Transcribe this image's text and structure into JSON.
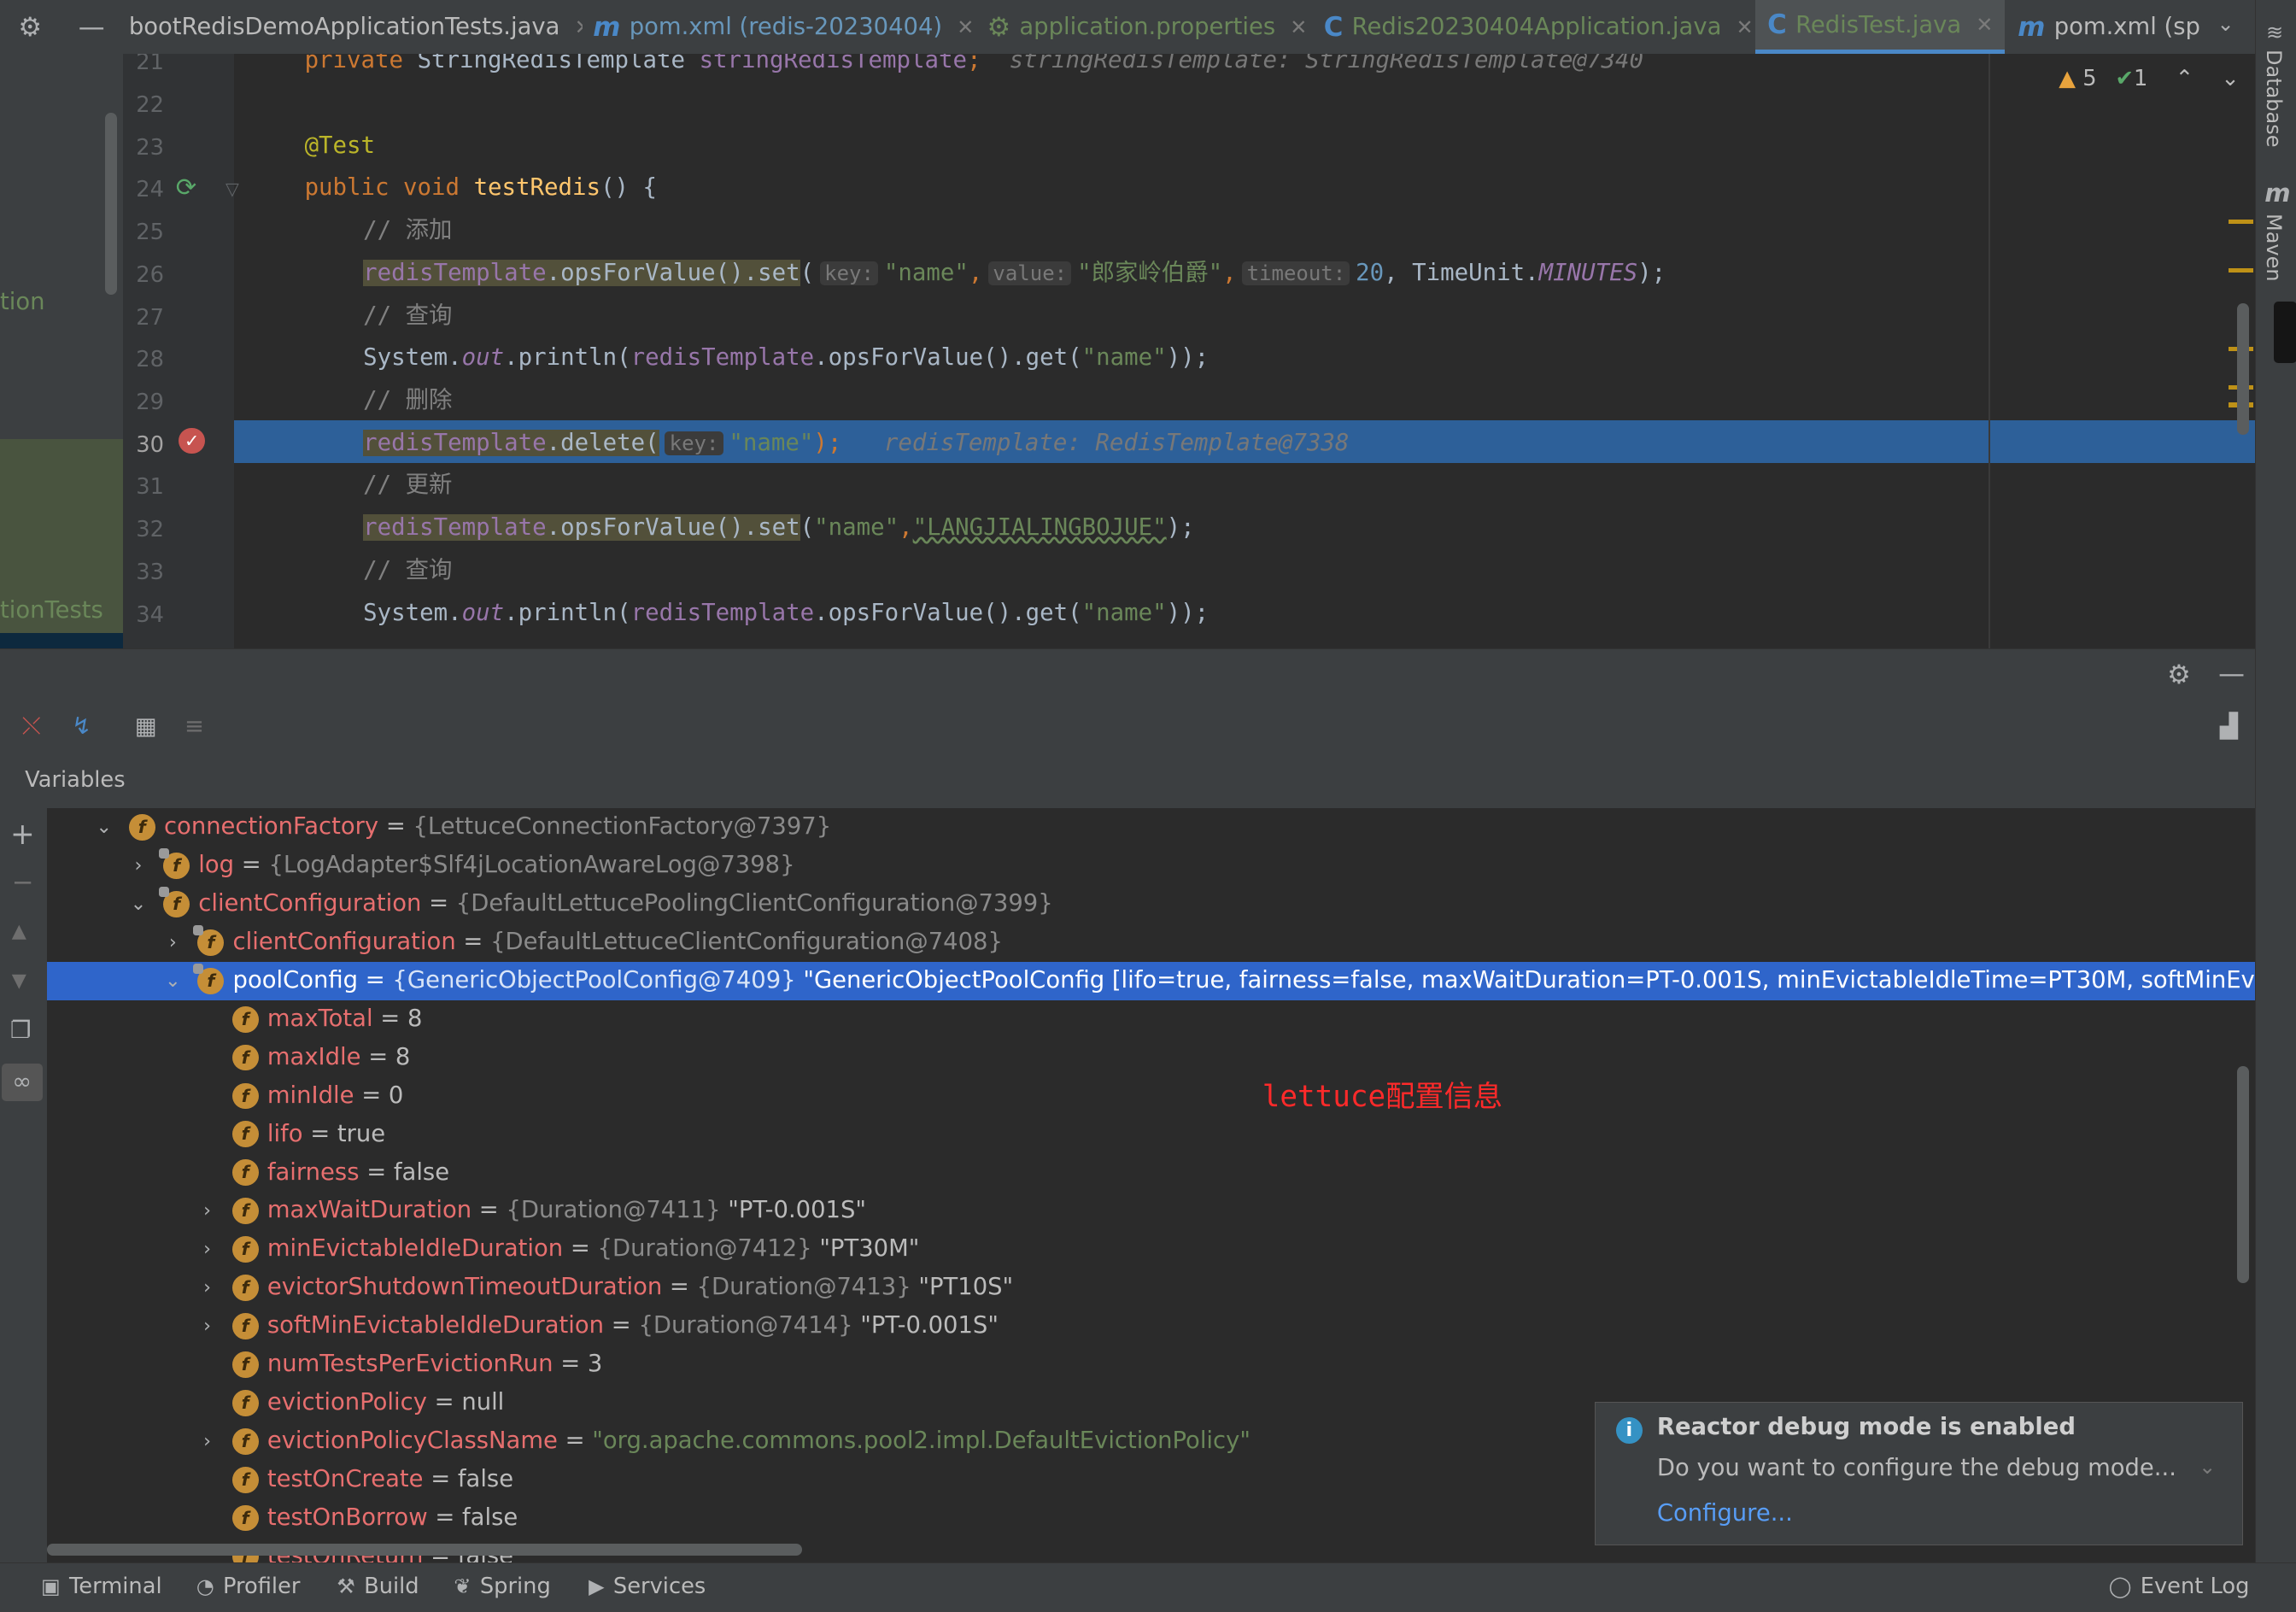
{
  "tabs": [
    {
      "label": "bootRedisDemoApplicationTests.java",
      "icon": ""
    },
    {
      "label": "pom.xml (redis-20230404)",
      "icon": "m"
    },
    {
      "label": "application.properties",
      "icon": "⚙"
    },
    {
      "label": "Redis20230404Application.java",
      "icon": "C"
    },
    {
      "label": "RedisTest.java",
      "icon": "C"
    },
    {
      "label": "pom.xml (spr",
      "icon": "m"
    }
  ],
  "inspections": {
    "warnings": "5",
    "ok": "1"
  },
  "project_tree": {
    "item1": "tion",
    "item2": "tionTests"
  },
  "right_tools": {
    "database": "Database",
    "maven": "Maven"
  },
  "editor": {
    "line_numbers": [
      "21",
      "22",
      "23",
      "24",
      "25",
      "26",
      "27",
      "28",
      "29",
      "30",
      "31",
      "32",
      "33",
      "34"
    ],
    "current_line": "30",
    "l21": {
      "kw": "private ",
      "type": "StringRedisTemplate ",
      "field": "stringRedisTemplate",
      "semi": ";",
      "inline": "stringRedisTemplate: StringRedisTemplate@7340"
    },
    "l23": "@Test",
    "l24": {
      "kw": "public void ",
      "fn": "testRedis",
      "rest": "() {"
    },
    "l25": "// 添加",
    "l26": {
      "field": "redisTemplate",
      "mid": ".opsForValue().set",
      "p1": "(",
      "h1": "key:",
      "s1": "\"name\"",
      "c1": ",",
      "h2": "value:",
      "s2": "\"郎家岭伯爵\"",
      "c2": ",",
      "h3": "timeout:",
      "n1": "20",
      "c3": ", TimeUnit.",
      "st": "MINUTES",
      "end": ");"
    },
    "l27": "// 查询",
    "l28": {
      "pre": "System.",
      "st": "out",
      "mid": ".println(",
      "field": "redisTemplate",
      "mid2": ".opsForValue().get(",
      "s1": "\"name\"",
      "end": "));"
    },
    "l29": "// 删除",
    "l30": {
      "field": "redisTemplate",
      "mid": ".delete(",
      "h1": "key:",
      "s1": "\"name\"",
      "end": ");",
      "inline": "redisTemplate: RedisTemplate@7338"
    },
    "l31": "// 更新",
    "l32": {
      "field": "redisTemplate",
      "mid": ".opsForValue().set",
      "p1": "(",
      "s1": "\"name\"",
      "c1": ",",
      "s2": "\"LANGJIALINGBOJUE\"",
      "end": ");"
    },
    "l33": "// 查询",
    "l34": {
      "pre": "System.",
      "st": "out",
      "mid": ".println(",
      "field": "redisTemplate",
      "mid2": ".opsForValue().get(",
      "s1": "\"name\"",
      "end": "));"
    }
  },
  "debug": {
    "variables_label": "Variables"
  },
  "variables": [
    {
      "name": "connectionFactory",
      "eq": " = ",
      "ref": "{LettuceConnectionFactory@7397}",
      "val": ""
    },
    {
      "name": "log",
      "eq": " = ",
      "ref": "{LogAdapter$Slf4jLocationAwareLog@7398}",
      "val": ""
    },
    {
      "name": "clientConfiguration",
      "eq": " = ",
      "ref": "{DefaultLettucePoolingClientConfiguration@7399}",
      "val": ""
    },
    {
      "name": "clientConfiguration",
      "eq": " = ",
      "ref": "{DefaultLettuceClientConfiguration@7408}",
      "val": ""
    },
    {
      "name": "poolConfig",
      "eq": " = ",
      "ref": "{GenericObjectPoolConfig@7409}",
      "val": " \"GenericObjectPoolConfig [lifo=true, fairness=false, maxWaitDuration=PT-0.001S, minEvictableIdleTime=PT30M, softMinEvictab... View"
    },
    {
      "name": "maxTotal",
      "eq": " = ",
      "ref": "",
      "val": "8"
    },
    {
      "name": "maxIdle",
      "eq": " = ",
      "ref": "",
      "val": "8"
    },
    {
      "name": "minIdle",
      "eq": " = ",
      "ref": "",
      "val": "0"
    },
    {
      "name": "lifo",
      "eq": " = ",
      "ref": "",
      "val": "true"
    },
    {
      "name": "fairness",
      "eq": " = ",
      "ref": "",
      "val": "false"
    },
    {
      "name": "maxWaitDuration",
      "eq": " = ",
      "ref": "{Duration@7411}",
      "val": " \"PT-0.001S\""
    },
    {
      "name": "minEvictableIdleDuration",
      "eq": " = ",
      "ref": "{Duration@7412}",
      "val": " \"PT30M\""
    },
    {
      "name": "evictorShutdownTimeoutDuration",
      "eq": " = ",
      "ref": "{Duration@7413}",
      "val": " \"PT10S\""
    },
    {
      "name": "softMinEvictableIdleDuration",
      "eq": " = ",
      "ref": "{Duration@7414}",
      "val": " \"PT-0.001S\""
    },
    {
      "name": "numTestsPerEvictionRun",
      "eq": " = ",
      "ref": "",
      "val": "3"
    },
    {
      "name": "evictionPolicy",
      "eq": " = ",
      "ref": "",
      "val": "null"
    },
    {
      "name": "evictionPolicyClassName",
      "eq": " = ",
      "ref": "",
      "val": "",
      "str": "\"org.apache.commons.pool2.impl.DefaultEvictionPolicy\""
    },
    {
      "name": "testOnCreate",
      "eq": " = ",
      "ref": "",
      "val": "false"
    },
    {
      "name": "testOnBorrow",
      "eq": " = ",
      "ref": "",
      "val": "false"
    },
    {
      "name": "testOnReturn",
      "eq": " = ",
      "ref": "",
      "val": "false"
    }
  ],
  "annotation": "lettuce配置信息",
  "notification": {
    "title": "Reactor debug mode is enabled",
    "message": "Do you want to configure the debug mode...",
    "link": "Configure..."
  },
  "bottom_tabs": [
    {
      "label": "Terminal",
      "icon": "terminal-icon"
    },
    {
      "label": "Profiler",
      "icon": "profiler-icon"
    },
    {
      "label": "Build",
      "icon": "hammer-icon"
    },
    {
      "label": "Spring",
      "icon": "spring-leaf-icon"
    },
    {
      "label": "Services",
      "icon": "services-icon"
    }
  ],
  "event_log": "Event Log",
  "colors": {
    "accent": "#2f65ca",
    "exec_line": "#2d6099",
    "annotation": "#ff2a2a"
  }
}
